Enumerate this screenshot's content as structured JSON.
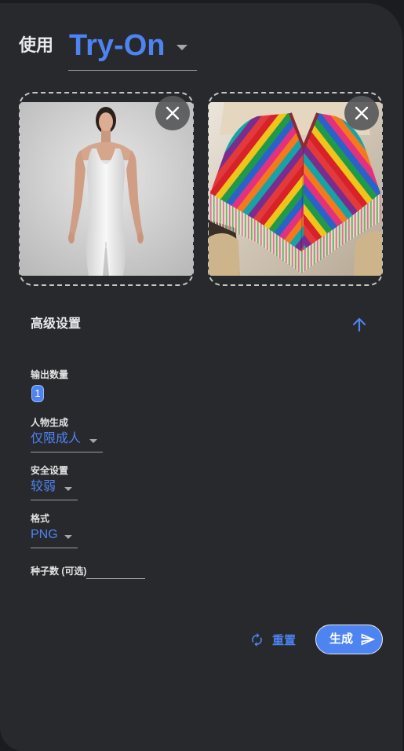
{
  "colors": {
    "accent": "#4d84f2",
    "panel": "#28292d",
    "background": "#1b1c1f",
    "text": "#e8eaed",
    "muted": "#9aa0a6"
  },
  "header": {
    "use_label": "使用",
    "model": {
      "value": "Try-On",
      "icon": "chevron-down-icon"
    }
  },
  "uploads": {
    "close_icon": "close-icon"
  },
  "advanced": {
    "title": "高级设置",
    "toggle_icon": "arrow-up-icon",
    "expanded": true,
    "output_count": {
      "label": "输出数量",
      "value": "1"
    },
    "person_generation": {
      "label": "人物生成",
      "value": "仅限成人",
      "icon": "chevron-down-icon"
    },
    "safety": {
      "label": "安全设置",
      "value": "较弱",
      "icon": "chevron-down-icon"
    },
    "format": {
      "label": "格式",
      "value": "PNG",
      "icon": "chevron-down-icon"
    },
    "seed": {
      "label": "种子数 (可选)",
      "value": ""
    }
  },
  "actions": {
    "reset": {
      "label": "重置",
      "icon": "refresh-icon"
    },
    "generate": {
      "label": "生成",
      "icon": "send-icon"
    }
  }
}
